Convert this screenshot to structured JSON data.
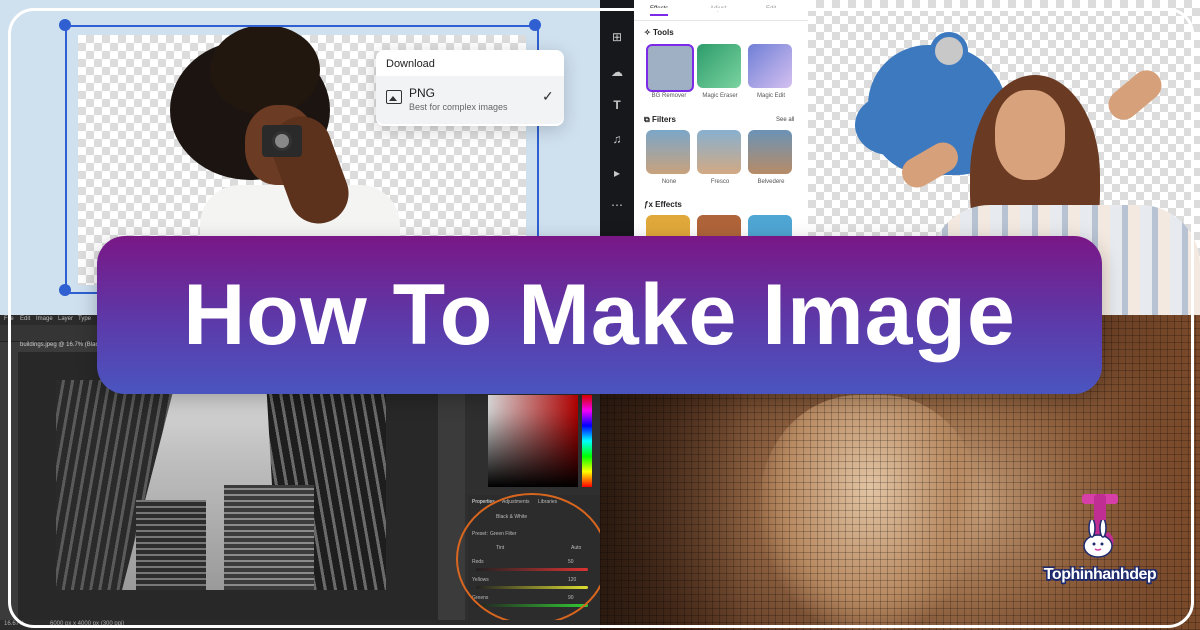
{
  "banner": {
    "title": "How To Make Image"
  },
  "download_menu": {
    "title": "Download",
    "format": "PNG",
    "description": "Best for complex images",
    "selected_icon": "check-icon"
  },
  "editor_panel": {
    "tabs": [
      "Effects",
      "Adjust",
      "Edit"
    ],
    "tools_heading": "Tools",
    "tools": [
      "BG Remover",
      "Magic Eraser",
      "Magic Edit"
    ],
    "filters_heading": "Filters",
    "see_all": "See all",
    "filters": [
      "None",
      "Fresco",
      "Belvedere"
    ],
    "effects_heading": "Effects"
  },
  "photoshop": {
    "menu": [
      "File",
      "Edit",
      "Image",
      "Layer",
      "Type"
    ],
    "document_tab": "buildings.jpeg @ 16.7% (Black",
    "panel_tabs": [
      "Properties",
      "Adjustments",
      "Libraries"
    ],
    "adjustment_name": "Black & White",
    "preset_label": "Preset:",
    "preset_value": "Green Filter",
    "tint_label": "Tint",
    "auto_label": "Auto",
    "sliders": [
      {
        "label": "Reds",
        "value": "50",
        "color": "#d33"
      },
      {
        "label": "Yellows",
        "value": "120",
        "color": "#dd3"
      },
      {
        "label": "Greens",
        "value": "90",
        "color": "#3c3"
      }
    ],
    "status": [
      "16.67%",
      "6000 px x 4000 px (300 ppi)"
    ]
  },
  "logo": {
    "text": "Tophinhanhdep"
  },
  "colors": {
    "banner_top": "#7a1786",
    "banner_bottom": "#4a55c0",
    "selection_blue": "#2f5fd1",
    "logo_outline": "#1e2a6e"
  }
}
